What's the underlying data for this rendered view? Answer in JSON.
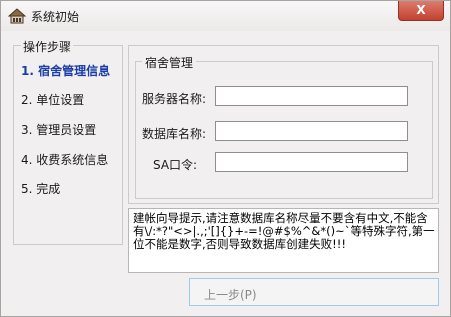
{
  "window": {
    "title": "系统初始",
    "close_label": "X"
  },
  "steps": {
    "legend": "操作步骤",
    "items": [
      {
        "label": "1. 宿舍管理信息",
        "active": true
      },
      {
        "label": "2. 单位设置"
      },
      {
        "label": "3. 管理员设置"
      },
      {
        "label": "4. 收费系统信息"
      },
      {
        "label": "5. 完成"
      }
    ]
  },
  "panel": {
    "legend": "宿舍管理",
    "server_label": "服务器名称:",
    "server_value": "",
    "database_label": "数据库名称:",
    "database_value": "",
    "sa_label": "SA口令:",
    "sa_value": ""
  },
  "hint": {
    "text": "建帐向导提示,请注意数据库名称尽量不要含有中文,不能含有\\/:*?\"<>|.,;'[]{}+-=!@#$%^&*()~`等特殊字符,第一位不能是数字,否则导致数据库创建失败!!!"
  },
  "buttons": {
    "prev": "上一步(P)"
  }
}
